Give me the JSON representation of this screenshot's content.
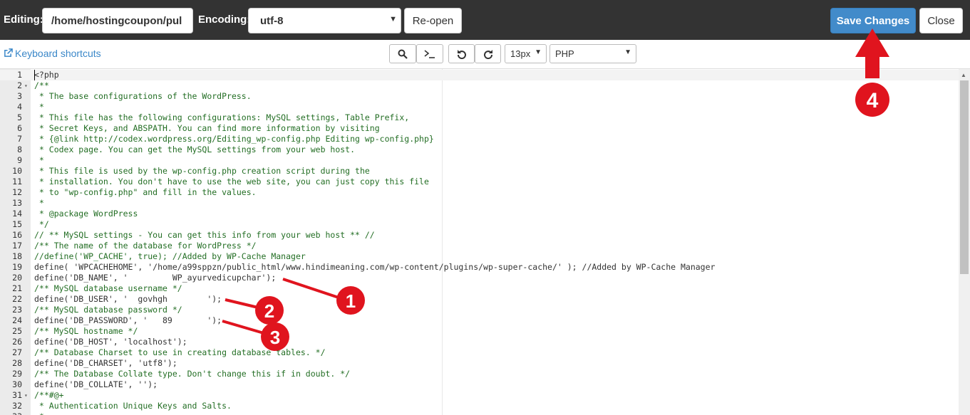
{
  "topbar": {
    "editing_label": "Editing:",
    "file_path": "/home/hostingcoupon/pul",
    "encoding_label": "Encoding:",
    "encoding_value": "utf-8",
    "reopen_label": "Re-open",
    "save_label": "Save Changes",
    "close_label": "Close"
  },
  "toolbar": {
    "keyboard_shortcuts_label": "Keyboard shortcuts",
    "search_icon": "search-icon",
    "terminal_icon": "terminal-icon",
    "undo_icon": "undo-icon",
    "redo_icon": "redo-icon",
    "font_size": "13px",
    "mode": "PHP"
  },
  "editor": {
    "lines": [
      {
        "n": "1",
        "fold": "",
        "text": "<?php"
      },
      {
        "n": "2",
        "fold": "▾",
        "text": "/**"
      },
      {
        "n": "3",
        "fold": "",
        "text": " * The base configurations of the WordPress."
      },
      {
        "n": "4",
        "fold": "",
        "text": " *"
      },
      {
        "n": "5",
        "fold": "",
        "text": " * This file has the following configurations: MySQL settings, Table Prefix,"
      },
      {
        "n": "6",
        "fold": "",
        "text": " * Secret Keys, and ABSPATH. You can find more information by visiting"
      },
      {
        "n": "7",
        "fold": "",
        "text": " * {@link http://codex.wordpress.org/Editing_wp-config.php Editing wp-config.php}"
      },
      {
        "n": "8",
        "fold": "",
        "text": " * Codex page. You can get the MySQL settings from your web host."
      },
      {
        "n": "9",
        "fold": "",
        "text": " *"
      },
      {
        "n": "10",
        "fold": "",
        "text": " * This file is used by the wp-config.php creation script during the"
      },
      {
        "n": "11",
        "fold": "",
        "text": " * installation. You don't have to use the web site, you can just copy this file"
      },
      {
        "n": "12",
        "fold": "",
        "text": " * to \"wp-config.php\" and fill in the values."
      },
      {
        "n": "13",
        "fold": "",
        "text": " *"
      },
      {
        "n": "14",
        "fold": "",
        "text": " * @package WordPress"
      },
      {
        "n": "15",
        "fold": "",
        "text": " */"
      },
      {
        "n": "16",
        "fold": "",
        "text": "// ** MySQL settings - You can get this info from your web host ** //"
      },
      {
        "n": "17",
        "fold": "",
        "text": "/** The name of the database for WordPress */"
      },
      {
        "n": "18",
        "fold": "",
        "text": "//define('WP_CACHE', true); //Added by WP-Cache Manager"
      },
      {
        "n": "19",
        "fold": "",
        "text": "define( 'WPCACHEHOME', '/home/a99sppzn/public_html/www.hindimeaning.com/wp-content/plugins/wp-super-cache/' ); //Added by WP-Cache Manager"
      },
      {
        "n": "20",
        "fold": "",
        "text": "define('DB_NAME', '         WP_ayurvedicupchar');"
      },
      {
        "n": "21",
        "fold": "",
        "text": "/** MySQL database username */"
      },
      {
        "n": "22",
        "fold": "",
        "text": "define('DB_USER', '  govhgh        ');"
      },
      {
        "n": "23",
        "fold": "",
        "text": "/** MySQL database password */"
      },
      {
        "n": "24",
        "fold": "",
        "text": "define('DB_PASSWORD', '   89       ');"
      },
      {
        "n": "25",
        "fold": "",
        "text": "/** MySQL hostname */"
      },
      {
        "n": "26",
        "fold": "",
        "text": "define('DB_HOST', 'localhost');"
      },
      {
        "n": "27",
        "fold": "",
        "text": "/** Database Charset to use in creating database tables. */"
      },
      {
        "n": "28",
        "fold": "",
        "text": "define('DB_CHARSET', 'utf8');"
      },
      {
        "n": "29",
        "fold": "",
        "text": "/** The Database Collate type. Don't change this if in doubt. */"
      },
      {
        "n": "30",
        "fold": "",
        "text": "define('DB_COLLATE', '');"
      },
      {
        "n": "31",
        "fold": "▾",
        "text": "/**#@+"
      },
      {
        "n": "32",
        "fold": "",
        "text": " * Authentication Unique Keys and Salts."
      },
      {
        "n": "33",
        "fold": "",
        "text": " *"
      }
    ]
  },
  "annotations": {
    "markers": [
      "1",
      "2",
      "3",
      "4"
    ],
    "color": "#e0141e"
  }
}
